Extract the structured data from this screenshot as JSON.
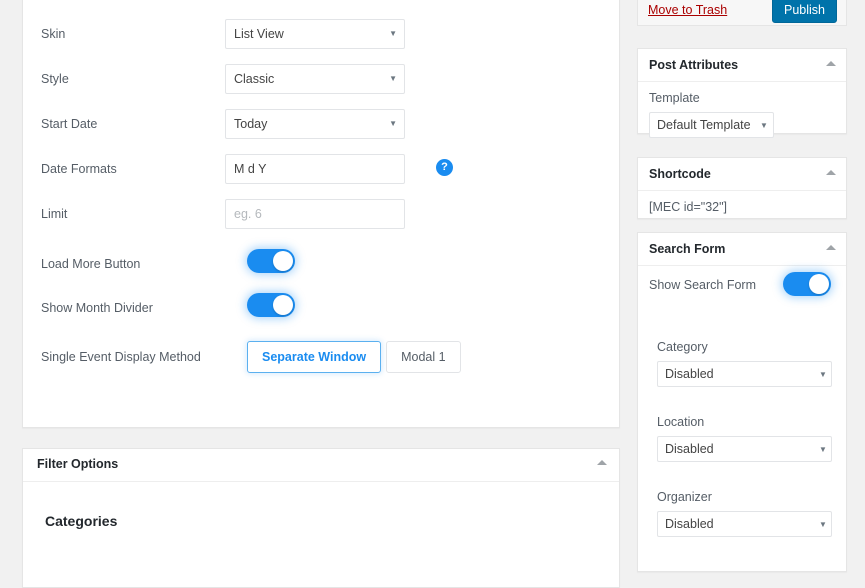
{
  "main": {
    "settings_rows": [
      {
        "label": "Skin",
        "type": "select",
        "value": "List View"
      },
      {
        "label": "Style",
        "type": "select",
        "value": "Classic"
      },
      {
        "label": "Start Date",
        "type": "select",
        "value": "Today"
      },
      {
        "label": "Date Formats",
        "type": "text",
        "value": "M d Y",
        "has_help": true
      },
      {
        "label": "Limit",
        "type": "text",
        "value": "",
        "placeholder": "eg. 6"
      },
      {
        "label": "Load More Button",
        "type": "toggle",
        "value": "on"
      },
      {
        "label": "Show Month Divider",
        "type": "toggle",
        "value": "on"
      },
      {
        "label": "Single Event Display Method",
        "type": "segmented"
      }
    ],
    "segmented_options": [
      {
        "label": "Separate Window",
        "selected": true
      },
      {
        "label": "Modal 1",
        "selected": false
      }
    ],
    "help_icon_glyph": "?",
    "filter_options": {
      "title": "Filter Options",
      "categories_heading": "Categories"
    }
  },
  "sidebar": {
    "publish_box": {
      "trash_label": "Move to Trash",
      "publish_label": "Publish"
    },
    "post_attributes": {
      "title": "Post Attributes",
      "template_label": "Template",
      "template_value": "Default Template"
    },
    "shortcode": {
      "title": "Shortcode",
      "value": "[MEC id=\"32\"]"
    },
    "search_form": {
      "title": "Search Form",
      "show_label": "Show Search Form",
      "show_value": "on",
      "fields": [
        {
          "label": "Category",
          "value": "Disabled"
        },
        {
          "label": "Location",
          "value": "Disabled"
        },
        {
          "label": "Organizer",
          "value": "Disabled"
        }
      ]
    }
  },
  "colors": {
    "publish_blue": "#0073aa",
    "toggle_blue": "#1a8cf0",
    "trash_red": "#a00000",
    "accent_blue": "#1a8cf0",
    "page_background": "#f1f1f1"
  },
  "icons": {
    "collapse": "▲",
    "select_arrow": "▼"
  }
}
